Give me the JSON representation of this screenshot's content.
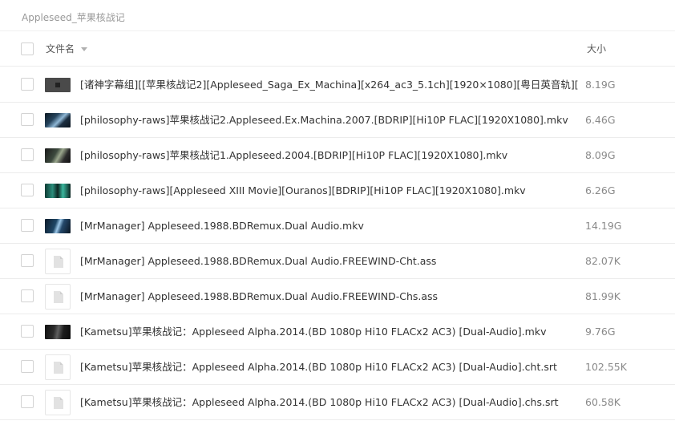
{
  "breadcrumb": "Appleseed_苹果核战记",
  "header": {
    "name_label": "文件名",
    "size_label": "大小"
  },
  "files": [
    {
      "name": "[诸神字幕组][[苹果核战记2][Appleseed_Saga_Ex_Machina][x264_ac3_5.1ch][1920×1080][粤日英音轨][...",
      "size": "8.19G",
      "icon": "video-thumbnail"
    },
    {
      "name": "[philosophy-raws]苹果核战记2.Appleseed.Ex.Machina.2007.[BDRIP][Hi10P FLAC][1920X1080].mkv",
      "size": "6.46G",
      "icon": "video-thumbnail"
    },
    {
      "name": "[philosophy-raws]苹果核战记1.Appleseed.2004.[BDRIP][Hi10P FLAC][1920X1080].mkv",
      "size": "8.09G",
      "icon": "video-thumbnail"
    },
    {
      "name": "[philosophy-raws][Appleseed XIII Movie][Ouranos][BDRIP][Hi10P FLAC][1920X1080].mkv",
      "size": "6.26G",
      "icon": "video-thumbnail"
    },
    {
      "name": "[MrManager] Appleseed.1988.BDRemux.Dual Audio.mkv",
      "size": "14.19G",
      "icon": "video-thumbnail"
    },
    {
      "name": "[MrManager] Appleseed.1988.BDRemux.Dual Audio.FREEWIND-Cht.ass",
      "size": "82.07K",
      "icon": "document-icon"
    },
    {
      "name": "[MrManager] Appleseed.1988.BDRemux.Dual Audio.FREEWIND-Chs.ass",
      "size": "81.99K",
      "icon": "document-icon"
    },
    {
      "name": "[Kametsu]苹果核战记：Appleseed Alpha.2014.(BD 1080p Hi10 FLACx2 AC3) [Dual-Audio].mkv",
      "size": "9.76G",
      "icon": "video-thumbnail"
    },
    {
      "name": "[Kametsu]苹果核战记：Appleseed Alpha.2014.(BD 1080p Hi10 FLACx2 AC3) [Dual-Audio].cht.srt",
      "size": "102.55K",
      "icon": "document-icon"
    },
    {
      "name": "[Kametsu]苹果核战记：Appleseed Alpha.2014.(BD 1080p Hi10 FLACx2 AC3) [Dual-Audio].chs.srt",
      "size": "60.58K",
      "icon": "document-icon"
    }
  ]
}
